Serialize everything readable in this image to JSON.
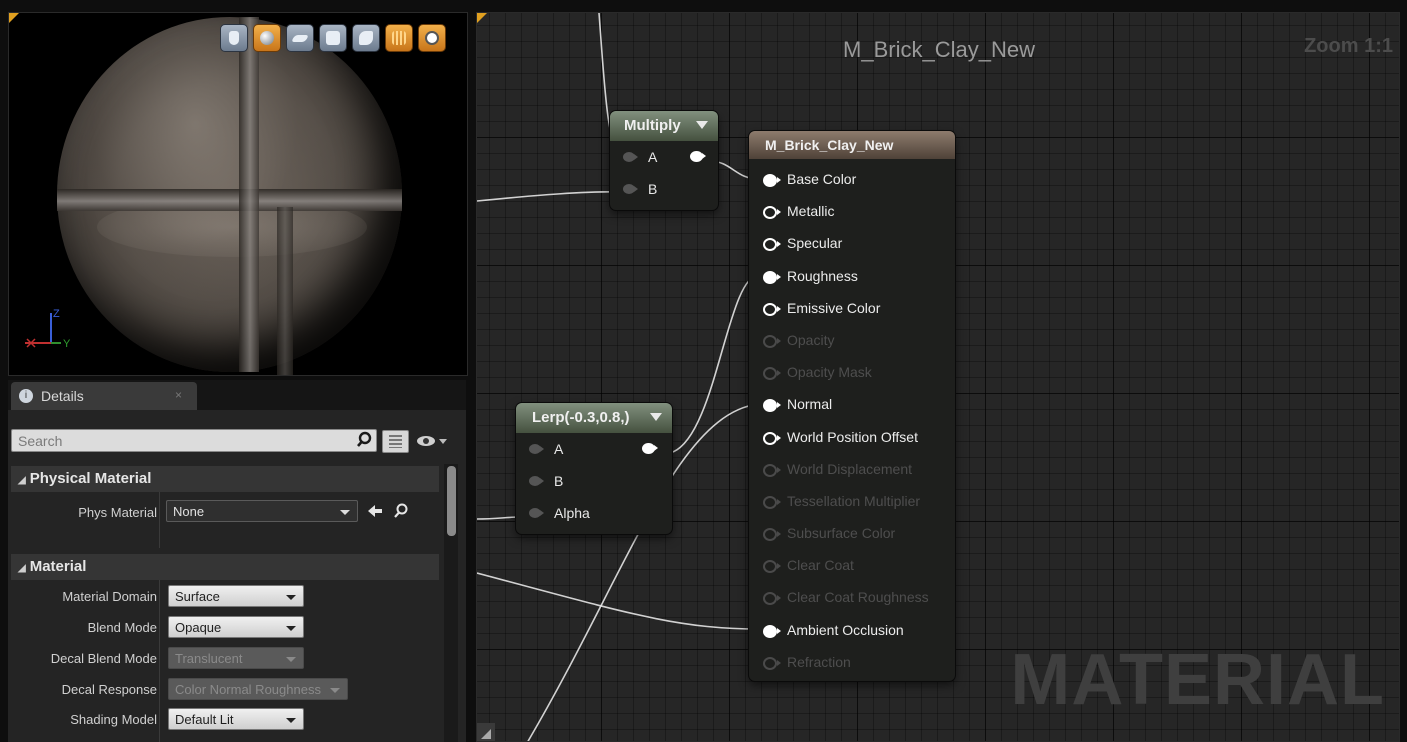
{
  "viewport": {
    "toolbar": [
      {
        "name": "cylinder-preview-icon",
        "active": false
      },
      {
        "name": "sphere-preview-icon",
        "active": true
      },
      {
        "name": "plane-preview-icon",
        "active": false
      },
      {
        "name": "cube-preview-icon",
        "active": false
      },
      {
        "name": "custom-mesh-preview-icon",
        "active": false
      },
      {
        "name": "grid-toggle-icon",
        "active": true
      },
      {
        "name": "realtime-toggle-icon",
        "active": true
      }
    ],
    "axes": {
      "z": "Z",
      "y": "Y"
    }
  },
  "details": {
    "tab_label": "Details",
    "tab_close": "×",
    "search_placeholder": "Search",
    "categories": {
      "physical": {
        "title": "Physical Material",
        "rows": [
          {
            "label": "Phys Material",
            "value": "None"
          }
        ]
      },
      "material": {
        "title": "Material",
        "rows": [
          {
            "label": "Material Domain",
            "value": "Surface"
          },
          {
            "label": "Blend Mode",
            "value": "Opaque"
          },
          {
            "label": "Decal Blend Mode",
            "value": "Translucent"
          },
          {
            "label": "Decal Response",
            "value": "Color Normal Roughness"
          },
          {
            "label": "Shading Model",
            "value": "Default Lit"
          }
        ]
      }
    }
  },
  "graph": {
    "title": "M_Brick_Clay_New",
    "zoom": "Zoom 1:1",
    "watermark": "MATERIAL",
    "multiply_node": {
      "title": "Multiply",
      "inputs": [
        "A",
        "B"
      ]
    },
    "lerp_node": {
      "title": "Lerp(-0.3,0.8,)",
      "inputs": [
        "A",
        "B",
        "Alpha"
      ]
    },
    "result_node": {
      "title": "M_Brick_Clay_New",
      "pins": [
        {
          "label": "Base Color",
          "enabled": true,
          "connected": true
        },
        {
          "label": "Metallic",
          "enabled": true,
          "connected": false
        },
        {
          "label": "Specular",
          "enabled": true,
          "connected": false
        },
        {
          "label": "Roughness",
          "enabled": true,
          "connected": true
        },
        {
          "label": "Emissive Color",
          "enabled": true,
          "connected": false
        },
        {
          "label": "Opacity",
          "enabled": false,
          "connected": false
        },
        {
          "label": "Opacity Mask",
          "enabled": false,
          "connected": false
        },
        {
          "label": "Normal",
          "enabled": true,
          "connected": true
        },
        {
          "label": "World Position Offset",
          "enabled": true,
          "connected": false
        },
        {
          "label": "World Displacement",
          "enabled": false,
          "connected": false
        },
        {
          "label": "Tessellation Multiplier",
          "enabled": false,
          "connected": false
        },
        {
          "label": "Subsurface Color",
          "enabled": false,
          "connected": false
        },
        {
          "label": "Clear Coat",
          "enabled": false,
          "connected": false
        },
        {
          "label": "Clear Coat Roughness",
          "enabled": false,
          "connected": false
        },
        {
          "label": "Ambient Occlusion",
          "enabled": true,
          "connected": true
        },
        {
          "label": "Refraction",
          "enabled": false,
          "connected": false
        }
      ]
    }
  },
  "colors": {
    "accent": "#e0a020",
    "node_header": "#6b7a68",
    "result_header": "#7a685a",
    "wire": "#e8e8e8"
  }
}
